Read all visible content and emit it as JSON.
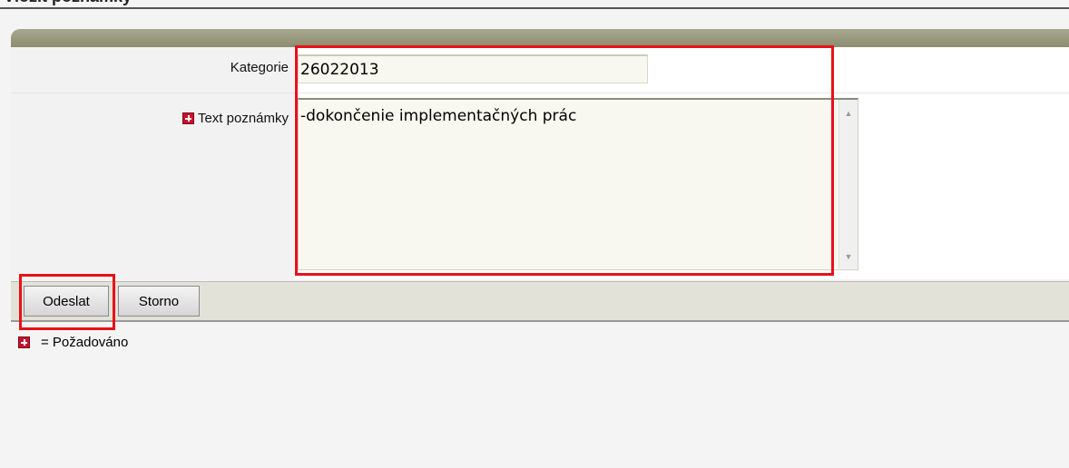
{
  "page": {
    "title": "Vložit poznámky"
  },
  "form": {
    "kategorie_label": "Kategorie",
    "kategorie_value": "26022013",
    "text_label": "Text poznámky",
    "text_value": "-dokončenie implementačných prác"
  },
  "buttons": {
    "submit_label": "Odeslat",
    "cancel_label": "Storno"
  },
  "legend": {
    "required_text": "= Požadováno"
  },
  "colors": {
    "highlight": "#e8101a",
    "required_icon": "#c8102e",
    "header_bar": "#8c8c70"
  },
  "icons": {
    "required": "required-asterisk-icon",
    "scroll_up": "scroll-up-arrow-icon",
    "scroll_down": "scroll-down-arrow-icon"
  }
}
